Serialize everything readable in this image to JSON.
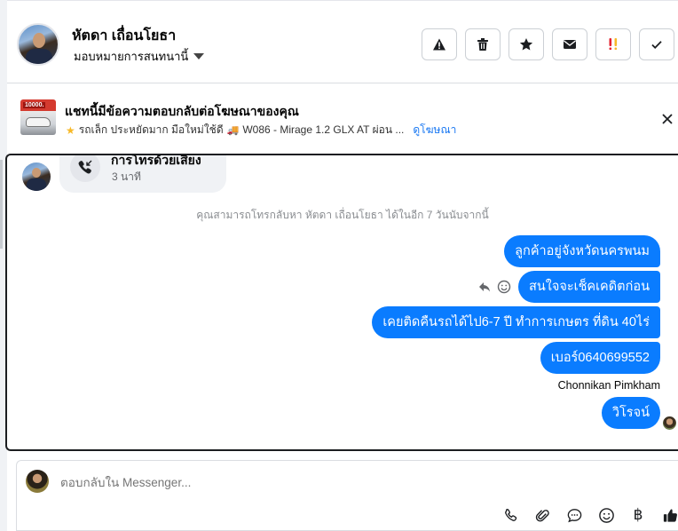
{
  "header": {
    "name": "หัตดา เถื่อนโยธา",
    "assign_label": "มอบหมายการสนทนานี้",
    "actions": [
      {
        "icon": "warning-icon",
        "name": "report-button"
      },
      {
        "icon": "trash-icon",
        "name": "delete-button"
      },
      {
        "icon": "star-icon",
        "name": "star-button"
      },
      {
        "icon": "envelope-icon",
        "name": "mark-unread-button"
      },
      {
        "icon": "spam-icon",
        "name": "spam-button"
      },
      {
        "icon": "checkmark-icon",
        "name": "mark-done-button"
      }
    ]
  },
  "ad": {
    "title": "แชทนี้มีข้อความตอบกลับต่อโฆษณาของคุณ",
    "thumb_price": "10000.",
    "desc_part1": "รถเล็ก ประหยัดมาก มือใหม่ใช้ดี",
    "desc_part2": "W086 - Mirage 1.2 GLX AT ผ่อน ...",
    "link": "ดูโฆษณา"
  },
  "chat": {
    "call_title": "การโทรด้วยเสียง",
    "call_time": "3 นาที",
    "system_note": "คุณสามารถโทรกลับหา หัตดา เถื่อนโยธา ได้ในอีก 7 วันนับจากนี้",
    "messages": [
      "ลูกค้าอยู่จังหวัดนครพนม",
      "สนใจจะเช็คเคดิตก่อน",
      "เคยติดคืนรถได้ไป6-7 ปี ทำการเกษตร ที่ดิน 40ไร่",
      "เบอร์0640699552",
      "วิโรจน์"
    ],
    "sender_name": "Chonnikan Pimkham"
  },
  "composer": {
    "placeholder": "ตอบกลับใน Messenger...",
    "currency_symbol": "฿"
  }
}
